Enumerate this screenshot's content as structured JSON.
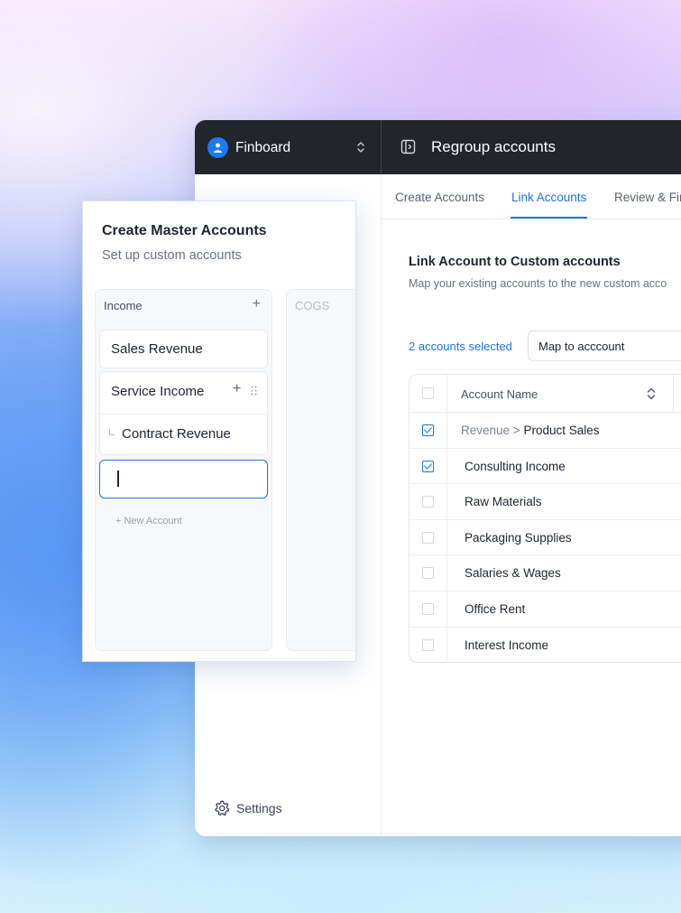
{
  "app": {
    "brand": "Finboard",
    "window_title": "Regroup accounts",
    "settings_label": "Settings"
  },
  "tabs": [
    {
      "label": "Create Accounts",
      "active": false
    },
    {
      "label": "Link Accounts",
      "active": true
    },
    {
      "label": "Review & Fin",
      "active": false
    }
  ],
  "link": {
    "title": "Link Account to Custom accounts",
    "subtitle": "Map your existing accounts to the new custom acco",
    "selected_count": "2 accounts selected",
    "map_select_value": "Map to acccount",
    "column_header": "Account Name",
    "rows": [
      {
        "prefix": "Revenue",
        "separator": ">",
        "name": "Product Sales",
        "checked": true
      },
      {
        "prefix": "",
        "separator": "",
        "name": "Consulting Income",
        "checked": true
      },
      {
        "prefix": "",
        "separator": "",
        "name": "Raw Materials",
        "checked": false
      },
      {
        "prefix": "",
        "separator": "",
        "name": "Packaging Supplies",
        "checked": false
      },
      {
        "prefix": "",
        "separator": "",
        "name": "Salaries & Wages",
        "checked": false
      },
      {
        "prefix": "",
        "separator": "",
        "name": "Office Rent",
        "checked": false
      },
      {
        "prefix": "",
        "separator": "",
        "name": "Interest Income",
        "checked": false
      }
    ]
  },
  "master": {
    "title": "Create Master Accounts",
    "subtitle": "Set up custom accounts",
    "columns": {
      "income": {
        "label": "Income",
        "add_symbol": "+",
        "accounts": [
          "Sales Revenue",
          "Service Income"
        ],
        "sub_account": "Contract Revenue",
        "new_account_label": "+ New Account"
      },
      "cogs": {
        "label": "COGS"
      }
    }
  },
  "colors": {
    "accent": "#1d73e8",
    "titlebar": "#23252b",
    "brand_avatar": "#1d7af2"
  },
  "icons": [
    "user-icon",
    "chevron-up-down-icon",
    "sidebar-panel-icon",
    "gear-icon",
    "sort-icon",
    "plus-icon",
    "drag-handle-icon"
  ]
}
